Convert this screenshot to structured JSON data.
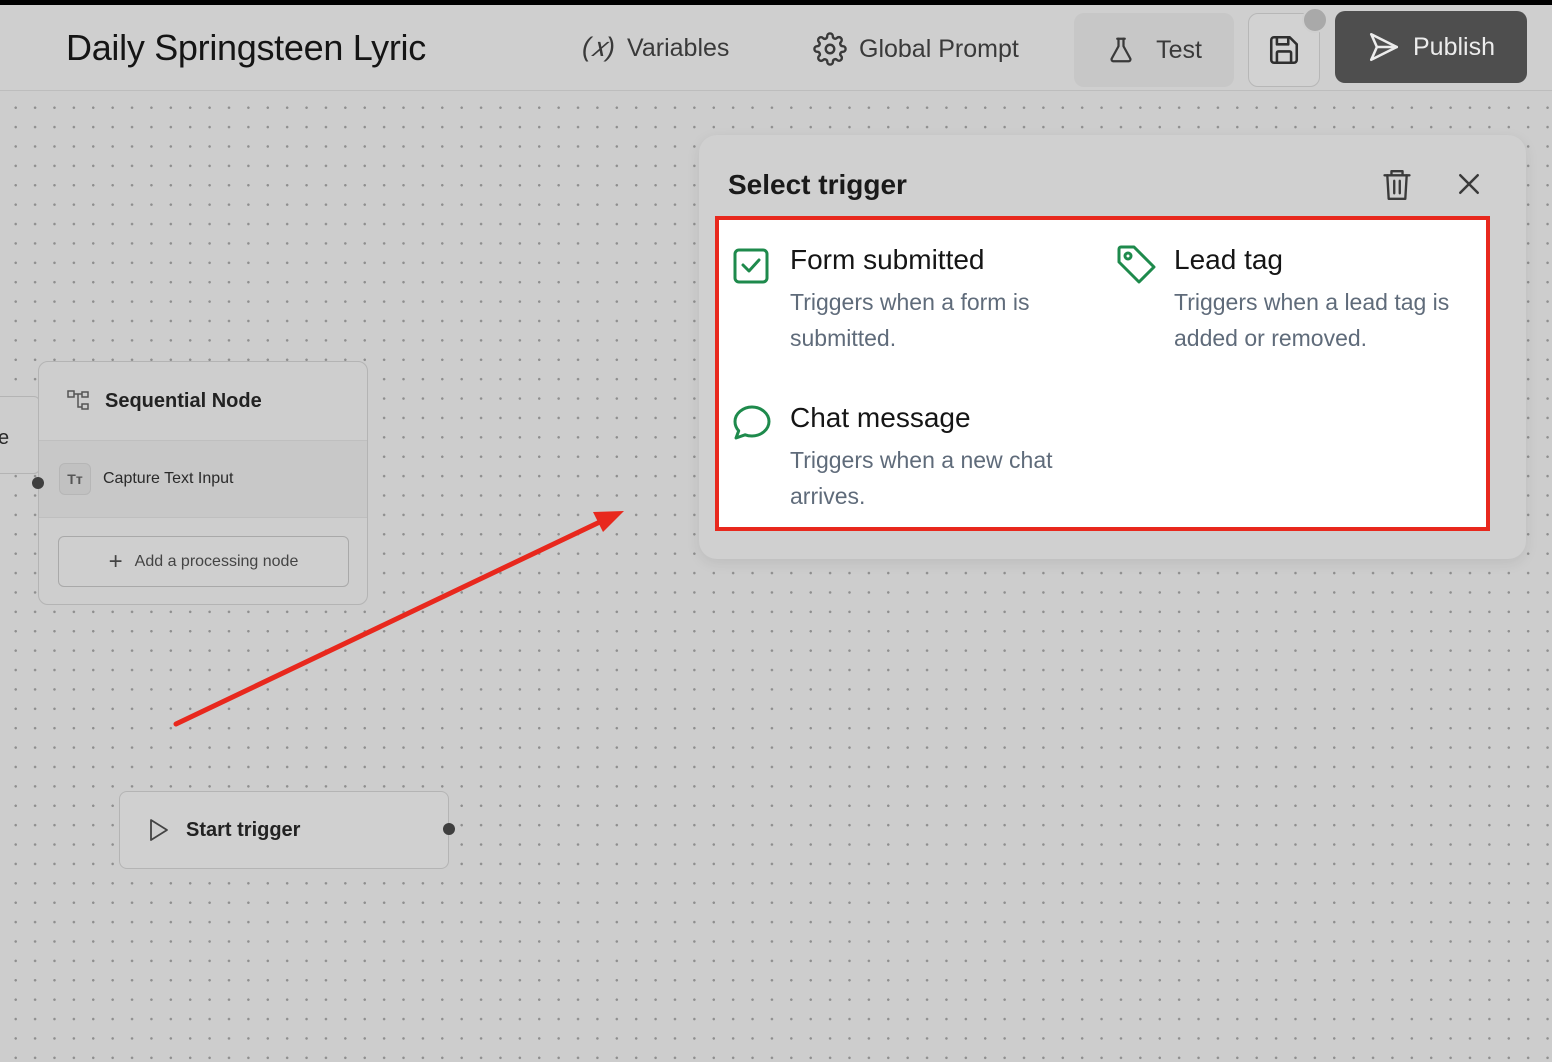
{
  "header": {
    "title": "Daily Springsteen Lyric",
    "variables_label": "Variables",
    "global_prompt_label": "Global Prompt",
    "test_label": "Test",
    "publish_label": "Publish"
  },
  "canvas": {
    "stub_label": "e",
    "sequential_node": {
      "title": "Sequential Node",
      "step_label": "Capture Text Input",
      "step_badge": "Tт",
      "add_label": "Add a processing node"
    },
    "start_node": {
      "label": "Start trigger"
    },
    "annotation_color": "#e8281d"
  },
  "trigger_panel": {
    "title": "Select trigger",
    "accent_color": "#1e8a4c",
    "options": [
      {
        "icon": "checkbox-icon",
        "title": "Form submitted",
        "description": "Triggers when a form is submitted."
      },
      {
        "icon": "tag-icon",
        "title": "Lead tag",
        "description": "Triggers when a lead tag is added or removed."
      },
      {
        "icon": "chat-bubble-icon",
        "title": "Chat message",
        "description": "Triggers when a new chat arrives."
      }
    ]
  }
}
